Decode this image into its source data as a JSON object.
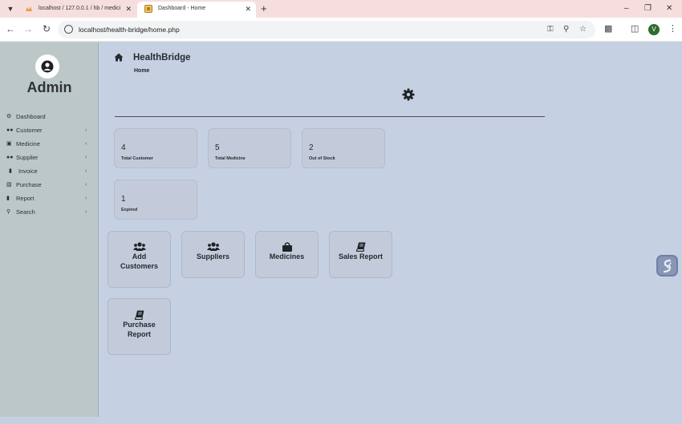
{
  "browser": {
    "tabs": [
      {
        "title": "localhost / 127.0.0.1 / hb / medici",
        "active": false,
        "favicon": "phpmyadmin-icon"
      },
      {
        "title": "Dashboard - Home",
        "active": true,
        "favicon": "site-icon"
      }
    ],
    "url": "localhost/health-bridge/home.php",
    "profile_initial": "V"
  },
  "sidebar": {
    "title": "Admin",
    "items": [
      {
        "label": "Dashboard",
        "icon": "dashboard-icon",
        "has_submenu": false
      },
      {
        "label": "Customer",
        "icon": "users-icon",
        "has_submenu": true
      },
      {
        "label": "Medicine",
        "icon": "shopping-bag-icon",
        "has_submenu": true
      },
      {
        "label": "Supplier",
        "icon": "users-icon",
        "has_submenu": true
      },
      {
        "label": "Invoice",
        "icon": "file-icon",
        "has_submenu": true
      },
      {
        "label": "Purchase",
        "icon": "bar-chart-icon",
        "has_submenu": true
      },
      {
        "label": "Report",
        "icon": "book-icon",
        "has_submenu": true
      },
      {
        "label": "Search",
        "icon": "search-icon",
        "has_submenu": true
      }
    ]
  },
  "header": {
    "brand": "HealthBridge",
    "breadcrumb": "Home"
  },
  "stats": [
    {
      "value": "4",
      "label": "Total Customer"
    },
    {
      "value": "5",
      "label": "Total Medicine"
    },
    {
      "value": "2",
      "label": "Out of Stock"
    },
    {
      "value": "1",
      "label": "Expired"
    }
  ],
  "quick_actions": [
    {
      "line1": "Add",
      "line2": "Customers",
      "icon": "users-icon"
    },
    {
      "line1": "Suppliers",
      "line2": "",
      "icon": "users-icon"
    },
    {
      "line1": "Medicines",
      "line2": "",
      "icon": "shopping-bag-icon"
    },
    {
      "line1": "Sales Report",
      "line2": "",
      "icon": "book-icon"
    },
    {
      "line1": "Purchase",
      "line2": "Report",
      "icon": "book-icon"
    }
  ],
  "colors": {
    "page_bg": "#c5d1e3",
    "sidebar_bg": "#bcc8c8",
    "card_bg": "#c3cbda",
    "tabbar_bg": "#f7dede",
    "text": "#25292e"
  }
}
